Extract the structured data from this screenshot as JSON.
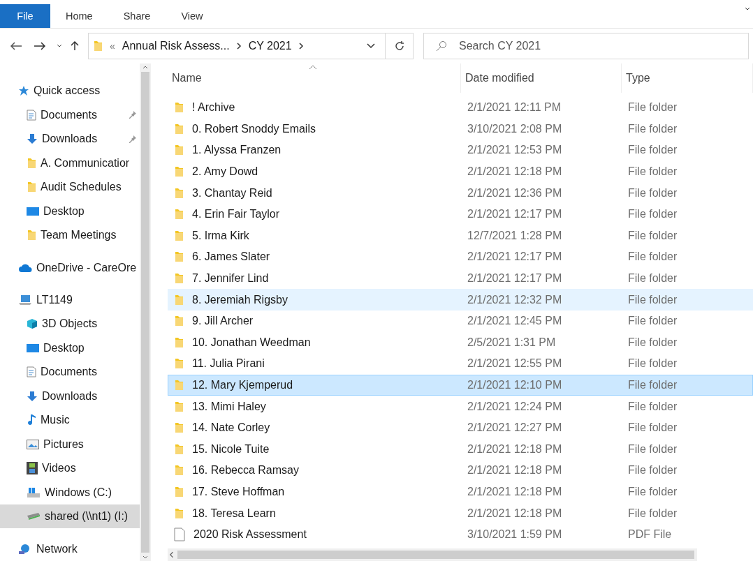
{
  "ribbon": {
    "tabs": [
      {
        "label": "File",
        "selected": true
      },
      {
        "label": "Home",
        "selected": false
      },
      {
        "label": "Share",
        "selected": false
      },
      {
        "label": "View",
        "selected": false
      }
    ]
  },
  "address": {
    "overflow": "«",
    "crumbs": [
      "Annual Risk Assess...",
      "CY 2021"
    ]
  },
  "search": {
    "placeholder": "Search CY 2021"
  },
  "sidebar": {
    "groups": [
      {
        "label": "Quick access",
        "kind": "star",
        "selected": false,
        "children": [
          {
            "label": "Documents",
            "kind": "document",
            "pinned": true,
            "selected": false
          },
          {
            "label": "Downloads",
            "kind": "download",
            "pinned": true,
            "selected": false
          },
          {
            "label": "A. Communicatior",
            "kind": "folder",
            "pinned": false,
            "selected": false
          },
          {
            "label": "Audit Schedules",
            "kind": "folder",
            "pinned": false,
            "selected": false
          },
          {
            "label": "Desktop",
            "kind": "desktop",
            "pinned": false,
            "selected": false
          },
          {
            "label": "Team Meetings",
            "kind": "folder",
            "pinned": false,
            "selected": false
          }
        ]
      },
      {
        "label": "OneDrive - CareOre",
        "kind": "cloud",
        "selected": false
      },
      {
        "label": "LT1149",
        "kind": "computer",
        "selected": false,
        "children": [
          {
            "label": "3D Objects",
            "kind": "cube",
            "pinned": false,
            "selected": false
          },
          {
            "label": "Desktop",
            "kind": "desktop",
            "pinned": false,
            "selected": false
          },
          {
            "label": "Documents",
            "kind": "document",
            "pinned": false,
            "selected": false
          },
          {
            "label": "Downloads",
            "kind": "download",
            "pinned": false,
            "selected": false
          },
          {
            "label": "Music",
            "kind": "music",
            "pinned": false,
            "selected": false
          },
          {
            "label": "Pictures",
            "kind": "pictures",
            "pinned": false,
            "selected": false
          },
          {
            "label": "Videos",
            "kind": "videos",
            "pinned": false,
            "selected": false
          },
          {
            "label": "Windows (C:)",
            "kind": "drive",
            "pinned": false,
            "selected": false
          },
          {
            "label": "shared (\\\\nt1) (I:)",
            "kind": "netdrive",
            "pinned": false,
            "selected": true
          }
        ]
      },
      {
        "label": "Network",
        "kind": "network",
        "selected": false
      }
    ]
  },
  "table": {
    "columns": [
      "Name",
      "Date modified",
      "Type"
    ],
    "rows": [
      {
        "name": "! Archive",
        "date": "2/1/2021 12:11 PM",
        "type": "File folder",
        "kind": "folder",
        "selected": false,
        "hovered": false
      },
      {
        "name": "0. Robert Snoddy Emails",
        "date": "3/10/2021 2:08 PM",
        "type": "File folder",
        "kind": "folder",
        "selected": false,
        "hovered": false
      },
      {
        "name": "1. Alyssa Franzen",
        "date": "2/1/2021 12:53 PM",
        "type": "File folder",
        "kind": "folder",
        "selected": false,
        "hovered": false
      },
      {
        "name": "2. Amy Dowd",
        "date": "2/1/2021 12:18 PM",
        "type": "File folder",
        "kind": "folder",
        "selected": false,
        "hovered": false
      },
      {
        "name": "3. Chantay Reid",
        "date": "2/1/2021 12:36 PM",
        "type": "File folder",
        "kind": "folder",
        "selected": false,
        "hovered": false
      },
      {
        "name": "4. Erin Fair Taylor",
        "date": "2/1/2021 12:17 PM",
        "type": "File folder",
        "kind": "folder",
        "selected": false,
        "hovered": false
      },
      {
        "name": "5. Irma Kirk",
        "date": "12/7/2021 1:28 PM",
        "type": "File folder",
        "kind": "folder",
        "selected": false,
        "hovered": false
      },
      {
        "name": "6. James Slater",
        "date": "2/1/2021 12:17 PM",
        "type": "File folder",
        "kind": "folder",
        "selected": false,
        "hovered": false
      },
      {
        "name": "7. Jennifer Lind",
        "date": "2/1/2021 12:17 PM",
        "type": "File folder",
        "kind": "folder",
        "selected": false,
        "hovered": false
      },
      {
        "name": "8. Jeremiah Rigsby",
        "date": "2/1/2021 12:32 PM",
        "type": "File folder",
        "kind": "folder",
        "selected": false,
        "hovered": true
      },
      {
        "name": "9. Jill Archer",
        "date": "2/1/2021 12:45 PM",
        "type": "File folder",
        "kind": "folder",
        "selected": false,
        "hovered": false
      },
      {
        "name": "10. Jonathan Weedman",
        "date": "2/5/2021 1:31 PM",
        "type": "File folder",
        "kind": "folder",
        "selected": false,
        "hovered": false
      },
      {
        "name": "11. Julia Pirani",
        "date": "2/1/2021 12:55 PM",
        "type": "File folder",
        "kind": "folder",
        "selected": false,
        "hovered": false
      },
      {
        "name": "12. Mary Kjemperud",
        "date": "2/1/2021 12:10 PM",
        "type": "File folder",
        "kind": "folder",
        "selected": true,
        "hovered": false
      },
      {
        "name": "13. Mimi Haley",
        "date": "2/1/2021 12:24 PM",
        "type": "File folder",
        "kind": "folder",
        "selected": false,
        "hovered": false
      },
      {
        "name": "14. Nate Corley",
        "date": "2/1/2021 12:27 PM",
        "type": "File folder",
        "kind": "folder",
        "selected": false,
        "hovered": false
      },
      {
        "name": "15. Nicole Tuite",
        "date": "2/1/2021 12:18 PM",
        "type": "File folder",
        "kind": "folder",
        "selected": false,
        "hovered": false
      },
      {
        "name": "16. Rebecca Ramsay",
        "date": "2/1/2021 12:18 PM",
        "type": "File folder",
        "kind": "folder",
        "selected": false,
        "hovered": false
      },
      {
        "name": "17. Steve Hoffman",
        "date": "2/1/2021 12:18 PM",
        "type": "File folder",
        "kind": "folder",
        "selected": false,
        "hovered": false
      },
      {
        "name": "18. Teresa Learn",
        "date": "2/1/2021 12:18 PM",
        "type": "File folder",
        "kind": "folder",
        "selected": false,
        "hovered": false
      },
      {
        "name": "2020 Risk Assessment",
        "date": "3/10/2021 1:59 PM",
        "type": "PDF File",
        "kind": "file",
        "selected": false,
        "hovered": false
      }
    ]
  }
}
